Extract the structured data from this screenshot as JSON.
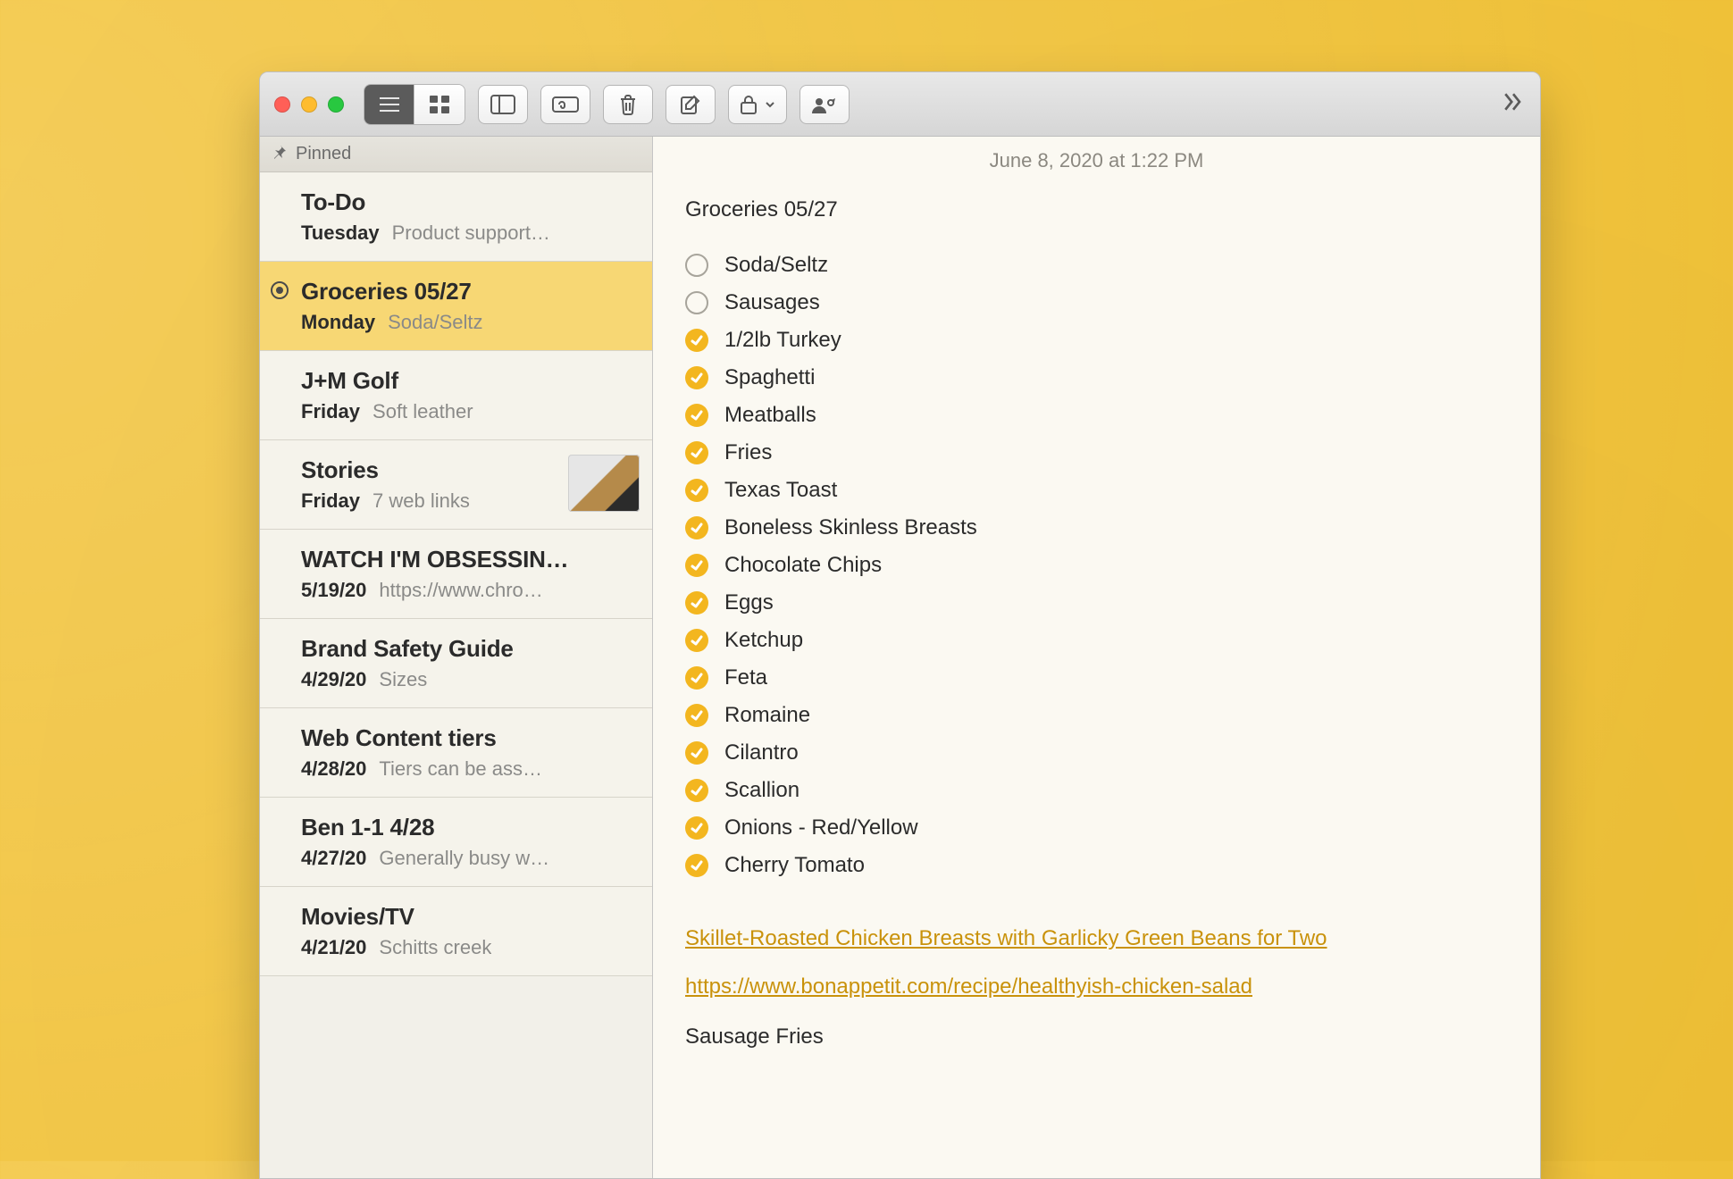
{
  "colors": {
    "accent": "#f3b61f",
    "selection": "#f7d774",
    "link": "#c9920b"
  },
  "toolbar": {
    "view_list_label": "List View",
    "view_grid_label": "Grid View",
    "folders_label": "Folders",
    "attachments_label": "Attachments",
    "trash_label": "Delete",
    "compose_label": "New Note",
    "lock_label": "Lock",
    "share_label": "Share",
    "more_label": "More"
  },
  "sidebar": {
    "pinned_label": "Pinned",
    "items": [
      {
        "title": "To-Do",
        "date": "Tuesday",
        "preview": "Product support…",
        "shared": false,
        "selected": false,
        "thumb": false
      },
      {
        "title": "Groceries 05/27",
        "date": "Monday",
        "preview": "Soda/Seltz",
        "shared": true,
        "selected": true,
        "thumb": false
      },
      {
        "title": "J+M Golf",
        "date": "Friday",
        "preview": "Soft leather",
        "shared": false,
        "selected": false,
        "thumb": false
      },
      {
        "title": "Stories",
        "date": "Friday",
        "preview": "7 web links",
        "shared": false,
        "selected": false,
        "thumb": true
      },
      {
        "title": "WATCH I'M OBSESSIN…",
        "date": "5/19/20",
        "preview": "https://www.chro…",
        "shared": false,
        "selected": false,
        "thumb": false
      },
      {
        "title": "Brand Safety Guide",
        "date": "4/29/20",
        "preview": "Sizes",
        "shared": false,
        "selected": false,
        "thumb": false
      },
      {
        "title": "Web Content tiers",
        "date": "4/28/20",
        "preview": "Tiers can be ass…",
        "shared": false,
        "selected": false,
        "thumb": false
      },
      {
        "title": "Ben 1-1 4/28",
        "date": "4/27/20",
        "preview": "Generally busy w…",
        "shared": false,
        "selected": false,
        "thumb": false
      },
      {
        "title": "Movies/TV",
        "date": "4/21/20",
        "preview": "Schitts creek",
        "shared": false,
        "selected": false,
        "thumb": false
      }
    ]
  },
  "note": {
    "timestamp": "June 8, 2020 at 1:22 PM",
    "title": "Groceries 05/27",
    "checklist": [
      {
        "text": "Soda/Seltz",
        "checked": false
      },
      {
        "text": "Sausages",
        "checked": false
      },
      {
        "text": "1/2lb Turkey",
        "checked": true
      },
      {
        "text": "Spaghetti",
        "checked": true
      },
      {
        "text": "Meatballs",
        "checked": true
      },
      {
        "text": "Fries",
        "checked": true
      },
      {
        "text": "Texas Toast",
        "checked": true
      },
      {
        "text": "Boneless Skinless Breasts",
        "checked": true
      },
      {
        "text": "Chocolate Chips",
        "checked": true
      },
      {
        "text": "Eggs",
        "checked": true
      },
      {
        "text": "Ketchup",
        "checked": true
      },
      {
        "text": "Feta",
        "checked": true
      },
      {
        "text": "Romaine",
        "checked": true
      },
      {
        "text": "Cilantro",
        "checked": true
      },
      {
        "text": "Scallion",
        "checked": true
      },
      {
        "text": "Onions - Red/Yellow",
        "checked": true
      },
      {
        "text": "Cherry Tomato",
        "checked": true
      }
    ],
    "links": [
      "Skillet-Roasted Chicken Breasts with Garlicky Green Beans for Two",
      "https://www.bonappetit.com/recipe/healthyish-chicken-salad"
    ],
    "footer_text": "Sausage Fries"
  }
}
